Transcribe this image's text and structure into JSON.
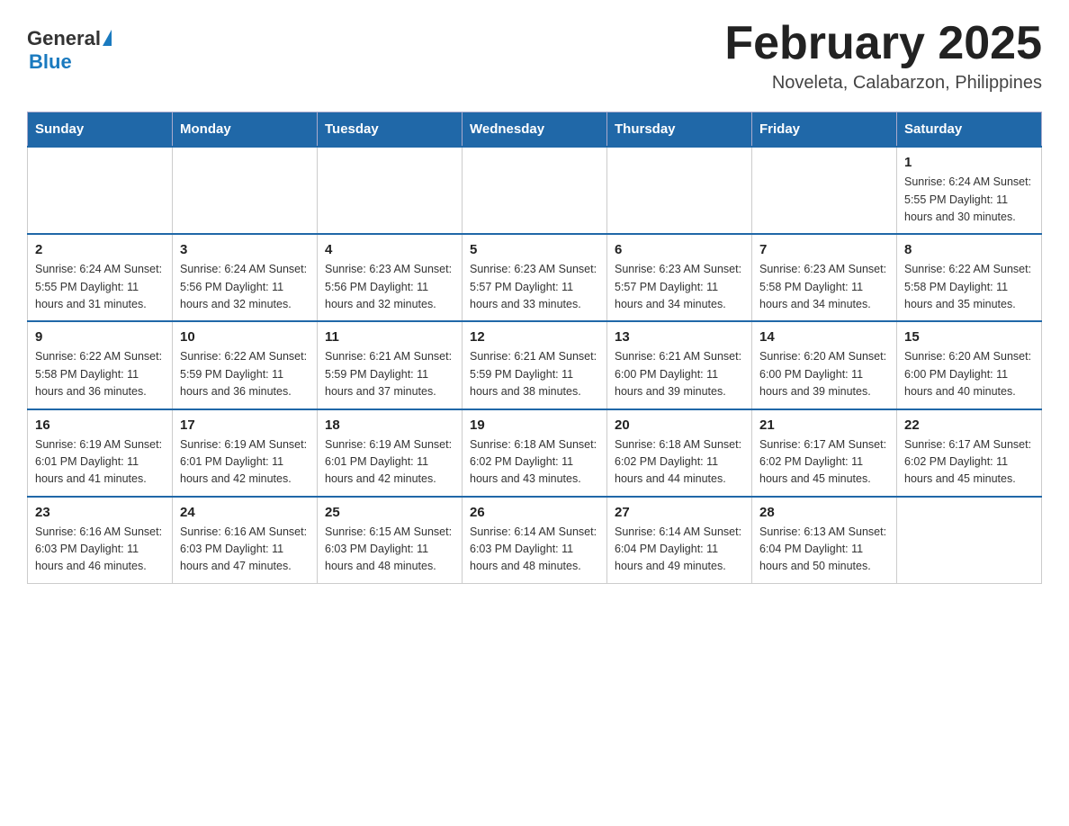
{
  "header": {
    "logo_general": "General",
    "logo_blue": "Blue",
    "month_title": "February 2025",
    "location": "Noveleta, Calabarzon, Philippines"
  },
  "days_of_week": [
    "Sunday",
    "Monday",
    "Tuesday",
    "Wednesday",
    "Thursday",
    "Friday",
    "Saturday"
  ],
  "weeks": [
    [
      {
        "day": "",
        "info": ""
      },
      {
        "day": "",
        "info": ""
      },
      {
        "day": "",
        "info": ""
      },
      {
        "day": "",
        "info": ""
      },
      {
        "day": "",
        "info": ""
      },
      {
        "day": "",
        "info": ""
      },
      {
        "day": "1",
        "info": "Sunrise: 6:24 AM\nSunset: 5:55 PM\nDaylight: 11 hours and 30 minutes."
      }
    ],
    [
      {
        "day": "2",
        "info": "Sunrise: 6:24 AM\nSunset: 5:55 PM\nDaylight: 11 hours and 31 minutes."
      },
      {
        "day": "3",
        "info": "Sunrise: 6:24 AM\nSunset: 5:56 PM\nDaylight: 11 hours and 32 minutes."
      },
      {
        "day": "4",
        "info": "Sunrise: 6:23 AM\nSunset: 5:56 PM\nDaylight: 11 hours and 32 minutes."
      },
      {
        "day": "5",
        "info": "Sunrise: 6:23 AM\nSunset: 5:57 PM\nDaylight: 11 hours and 33 minutes."
      },
      {
        "day": "6",
        "info": "Sunrise: 6:23 AM\nSunset: 5:57 PM\nDaylight: 11 hours and 34 minutes."
      },
      {
        "day": "7",
        "info": "Sunrise: 6:23 AM\nSunset: 5:58 PM\nDaylight: 11 hours and 34 minutes."
      },
      {
        "day": "8",
        "info": "Sunrise: 6:22 AM\nSunset: 5:58 PM\nDaylight: 11 hours and 35 minutes."
      }
    ],
    [
      {
        "day": "9",
        "info": "Sunrise: 6:22 AM\nSunset: 5:58 PM\nDaylight: 11 hours and 36 minutes."
      },
      {
        "day": "10",
        "info": "Sunrise: 6:22 AM\nSunset: 5:59 PM\nDaylight: 11 hours and 36 minutes."
      },
      {
        "day": "11",
        "info": "Sunrise: 6:21 AM\nSunset: 5:59 PM\nDaylight: 11 hours and 37 minutes."
      },
      {
        "day": "12",
        "info": "Sunrise: 6:21 AM\nSunset: 5:59 PM\nDaylight: 11 hours and 38 minutes."
      },
      {
        "day": "13",
        "info": "Sunrise: 6:21 AM\nSunset: 6:00 PM\nDaylight: 11 hours and 39 minutes."
      },
      {
        "day": "14",
        "info": "Sunrise: 6:20 AM\nSunset: 6:00 PM\nDaylight: 11 hours and 39 minutes."
      },
      {
        "day": "15",
        "info": "Sunrise: 6:20 AM\nSunset: 6:00 PM\nDaylight: 11 hours and 40 minutes."
      }
    ],
    [
      {
        "day": "16",
        "info": "Sunrise: 6:19 AM\nSunset: 6:01 PM\nDaylight: 11 hours and 41 minutes."
      },
      {
        "day": "17",
        "info": "Sunrise: 6:19 AM\nSunset: 6:01 PM\nDaylight: 11 hours and 42 minutes."
      },
      {
        "day": "18",
        "info": "Sunrise: 6:19 AM\nSunset: 6:01 PM\nDaylight: 11 hours and 42 minutes."
      },
      {
        "day": "19",
        "info": "Sunrise: 6:18 AM\nSunset: 6:02 PM\nDaylight: 11 hours and 43 minutes."
      },
      {
        "day": "20",
        "info": "Sunrise: 6:18 AM\nSunset: 6:02 PM\nDaylight: 11 hours and 44 minutes."
      },
      {
        "day": "21",
        "info": "Sunrise: 6:17 AM\nSunset: 6:02 PM\nDaylight: 11 hours and 45 minutes."
      },
      {
        "day": "22",
        "info": "Sunrise: 6:17 AM\nSunset: 6:02 PM\nDaylight: 11 hours and 45 minutes."
      }
    ],
    [
      {
        "day": "23",
        "info": "Sunrise: 6:16 AM\nSunset: 6:03 PM\nDaylight: 11 hours and 46 minutes."
      },
      {
        "day": "24",
        "info": "Sunrise: 6:16 AM\nSunset: 6:03 PM\nDaylight: 11 hours and 47 minutes."
      },
      {
        "day": "25",
        "info": "Sunrise: 6:15 AM\nSunset: 6:03 PM\nDaylight: 11 hours and 48 minutes."
      },
      {
        "day": "26",
        "info": "Sunrise: 6:14 AM\nSunset: 6:03 PM\nDaylight: 11 hours and 48 minutes."
      },
      {
        "day": "27",
        "info": "Sunrise: 6:14 AM\nSunset: 6:04 PM\nDaylight: 11 hours and 49 minutes."
      },
      {
        "day": "28",
        "info": "Sunrise: 6:13 AM\nSunset: 6:04 PM\nDaylight: 11 hours and 50 minutes."
      },
      {
        "day": "",
        "info": ""
      }
    ]
  ]
}
